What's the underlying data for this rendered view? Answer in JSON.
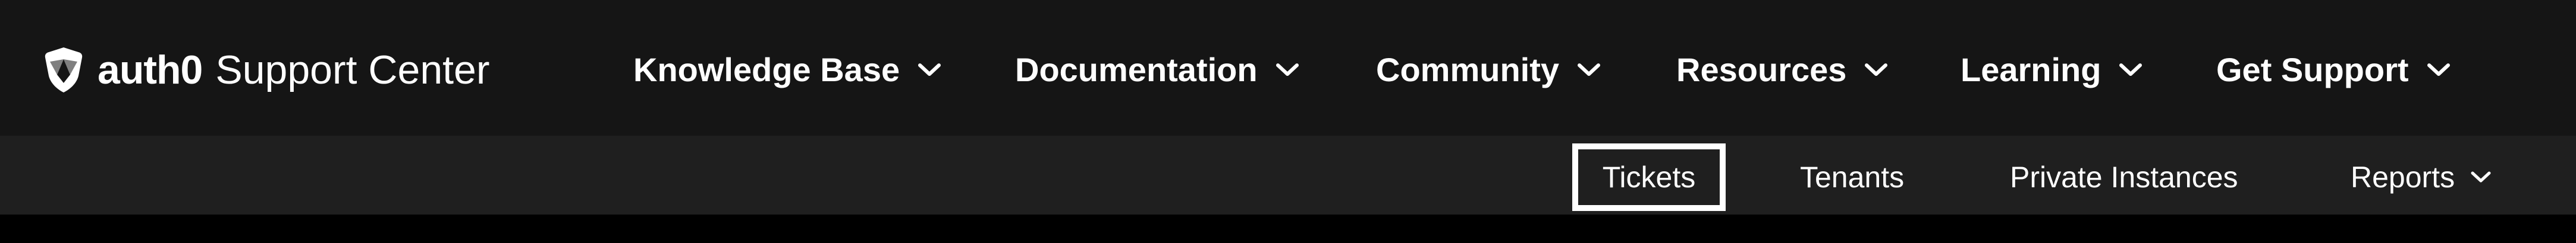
{
  "brand": {
    "logo_icon": "auth0-shield-icon",
    "name": "auth0",
    "product": "Support Center"
  },
  "main_nav": {
    "items": [
      {
        "label": "Knowledge Base",
        "icon": "chevron-down-icon"
      },
      {
        "label": "Documentation",
        "icon": "chevron-down-icon"
      },
      {
        "label": "Community",
        "icon": "chevron-down-icon"
      },
      {
        "label": "Resources",
        "icon": "chevron-down-icon"
      },
      {
        "label": "Learning",
        "icon": "chevron-down-icon"
      },
      {
        "label": "Get Support",
        "icon": "chevron-down-icon"
      }
    ]
  },
  "sub_nav": {
    "active": "Tickets",
    "items": [
      {
        "label": "Tickets"
      },
      {
        "label": "Tenants"
      },
      {
        "label": "Private Instances"
      },
      {
        "label": "Reports",
        "icon": "chevron-down-icon"
      }
    ]
  },
  "colors": {
    "topbar_bg": "#151515",
    "subbar_bg": "#1f1f1f",
    "page_bg": "#000000",
    "text": "#ffffff",
    "active_border": "#ffffff"
  }
}
